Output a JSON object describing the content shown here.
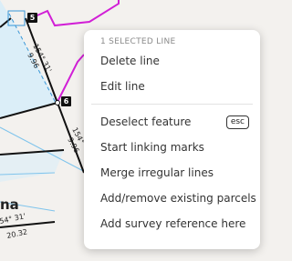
{
  "map": {
    "parcel_label": "na",
    "dimension_labels": [
      "154° 31'",
      "9.96",
      "154°",
      "9.96",
      "54° 31'",
      "20.32"
    ],
    "nodes": [
      "5",
      "6"
    ],
    "colors": {
      "background": "#f3f1ee",
      "parcel_fill": "#dbeef8",
      "magenta_line": "#d11fd6",
      "dashed_blue": "#3a98d8",
      "light_blue": "#7fc4ec",
      "boundary": "#111111"
    }
  },
  "context_menu": {
    "header": "1 SELECTED LINE",
    "items": [
      "Delete line",
      "Edit line",
      "Deselect feature",
      "Start linking marks",
      "Merge irregular lines",
      "Add/remove existing parcels",
      "Add survey reference here"
    ],
    "shortcut": "esc"
  }
}
